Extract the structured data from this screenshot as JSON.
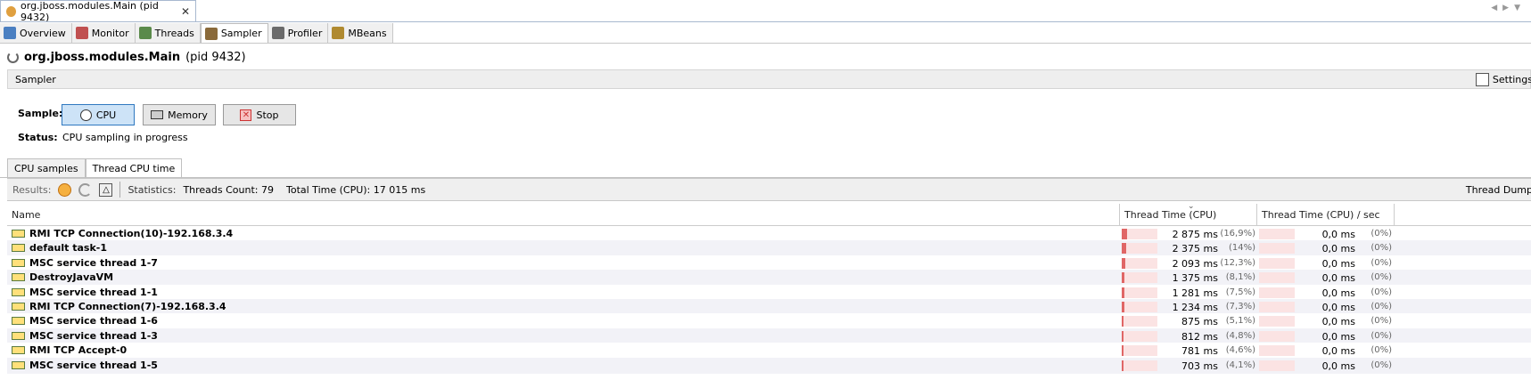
{
  "window": {
    "tab_title": "org.jboss.modules.Main (pid 9432)",
    "close_glyph": "✕"
  },
  "subtabs": [
    {
      "label": "Overview",
      "icon": "overview-icon",
      "color": "#4a7fc1"
    },
    {
      "label": "Monitor",
      "icon": "monitor-icon",
      "color": "#c05050"
    },
    {
      "label": "Threads",
      "icon": "threads-icon",
      "color": "#5a8a4a"
    },
    {
      "label": "Sampler",
      "icon": "sampler-icon",
      "color": "#8a6a3a",
      "active": true
    },
    {
      "label": "Profiler",
      "icon": "profiler-icon",
      "color": "#6a6a6a"
    },
    {
      "label": "MBeans",
      "icon": "mbeans-icon",
      "color": "#b08a30"
    }
  ],
  "header": {
    "app": "org.jboss.modules.Main",
    "pid": "(pid 9432)"
  },
  "sampler": {
    "title": "Sampler",
    "settings": "Settings"
  },
  "controls": {
    "sample_label": "Sample:",
    "cpu": "CPU",
    "memory": "Memory",
    "stop": "Stop",
    "status_label": "Status:",
    "status": "CPU sampling in progress"
  },
  "tabs": {
    "cpu_samples": "CPU samples",
    "thread_cpu_time": "Thread CPU time"
  },
  "results": {
    "label": "Results:",
    "stats_label": "Statistics:",
    "threads_count": "Threads Count: 79",
    "total_time": "Total Time (CPU): 17 015 ms",
    "thread_dump": "Thread Dump"
  },
  "columns": {
    "name": "Name",
    "thread_time": "Thread Time (CPU)",
    "per_sec": "Thread Time (CPU) / sec"
  },
  "rows": [
    {
      "name": "RMI TCP Connection(10)-192.168.3.4",
      "time": "2 875 ms",
      "pct": "(16,9%)",
      "frac": 0.169,
      "sec": "0,0 ms",
      "secpct": "(0%)"
    },
    {
      "name": "default task-1",
      "time": "2 375 ms",
      "pct": "(14%)",
      "frac": 0.14,
      "sec": "0,0 ms",
      "secpct": "(0%)"
    },
    {
      "name": "MSC service thread 1-7",
      "time": "2 093 ms",
      "pct": "(12,3%)",
      "frac": 0.123,
      "sec": "0,0 ms",
      "secpct": "(0%)"
    },
    {
      "name": "DestroyJavaVM",
      "time": "1 375 ms",
      "pct": "(8,1%)",
      "frac": 0.081,
      "sec": "0,0 ms",
      "secpct": "(0%)"
    },
    {
      "name": "MSC service thread 1-1",
      "time": "1 281 ms",
      "pct": "(7,5%)",
      "frac": 0.075,
      "sec": "0,0 ms",
      "secpct": "(0%)"
    },
    {
      "name": "RMI TCP Connection(7)-192.168.3.4",
      "time": "1 234 ms",
      "pct": "(7,3%)",
      "frac": 0.073,
      "sec": "0,0 ms",
      "secpct": "(0%)"
    },
    {
      "name": "MSC service thread 1-6",
      "time": "875 ms",
      "pct": "(5,1%)",
      "frac": 0.051,
      "sec": "0,0 ms",
      "secpct": "(0%)"
    },
    {
      "name": "MSC service thread 1-3",
      "time": "812 ms",
      "pct": "(4,8%)",
      "frac": 0.048,
      "sec": "0,0 ms",
      "secpct": "(0%)"
    },
    {
      "name": "RMI TCP Accept-0",
      "time": "781 ms",
      "pct": "(4,6%)",
      "frac": 0.046,
      "sec": "0,0 ms",
      "secpct": "(0%)"
    },
    {
      "name": "MSC service thread 1-5",
      "time": "703 ms",
      "pct": "(4,1%)",
      "frac": 0.041,
      "sec": "0,0 ms",
      "secpct": "(0%)"
    }
  ]
}
